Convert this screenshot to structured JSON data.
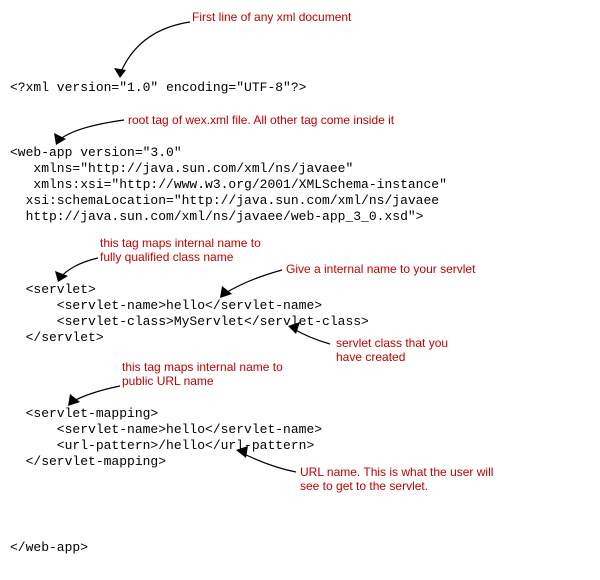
{
  "notes": {
    "n1": "First line of any xml document",
    "n2": "root tag of wex.xml file. All other tag come inside it",
    "n3a": "this tag maps internal name to",
    "n3b": "fully qualified class name",
    "n4": "Give a internal name to your servlet",
    "n5a": "servlet class that you",
    "n5b": "have created",
    "n6a": "this tag maps internal name to",
    "n6b": "public URL name",
    "n7a": "URL name. This is what the user will",
    "n7b": "see to get to the servlet."
  },
  "code": {
    "xmlDecl": "<?xml version=\"1.0\" encoding=\"UTF-8\"?>",
    "webAppOpen1": "<web-app version=\"3.0\"",
    "webAppOpen2": "   xmlns=\"http://java.sun.com/xml/ns/javaee\"",
    "webAppOpen3": "   xmlns:xsi=\"http://www.w3.org/2001/XMLSchema-instance\"",
    "webAppOpen4": "  xsi:schemaLocation=\"http://java.sun.com/xml/ns/javaee",
    "webAppOpen5": "  http://java.sun.com/xml/ns/javaee/web-app_3_0.xsd\">",
    "servletOpen": "  <servlet>",
    "servletName": "      <servlet-name>hello</servlet-name>",
    "servletClass": "      <servlet-class>MyServlet</servlet-class>",
    "servletClose": "  </servlet>",
    "mappingOpen": "  <servlet-mapping>",
    "mappingName": "      <servlet-name>hello</servlet-name>",
    "urlPattern": "      <url-pattern>/hello</url-pattern>",
    "mappingClose": "  </servlet-mapping>",
    "webAppClose": "</web-app>"
  }
}
